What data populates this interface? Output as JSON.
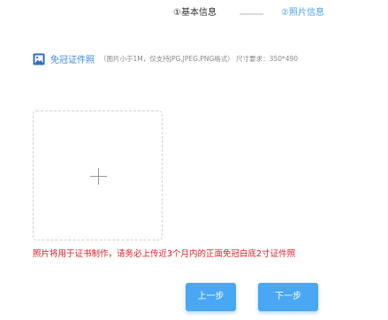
{
  "steps": {
    "step1": "①基本信息",
    "step2": "②照片信息"
  },
  "section": {
    "icon": "photo-icon",
    "title": "免冠证件照",
    "hint": "（图片小于1M，仅支持JPG,JPEG,PNG格式） 尺寸要求：350*490"
  },
  "upload": {
    "icon": "plus-icon"
  },
  "notice": "照片将用于证书制作，请务必上传近3个月内的正面免冠白底2寸证件照",
  "buttons": {
    "prev": "上一步",
    "next": "下一步"
  },
  "colors": {
    "accent": "#4aa7f4",
    "link": "#3f8ddc",
    "warning": "#e0202b"
  }
}
